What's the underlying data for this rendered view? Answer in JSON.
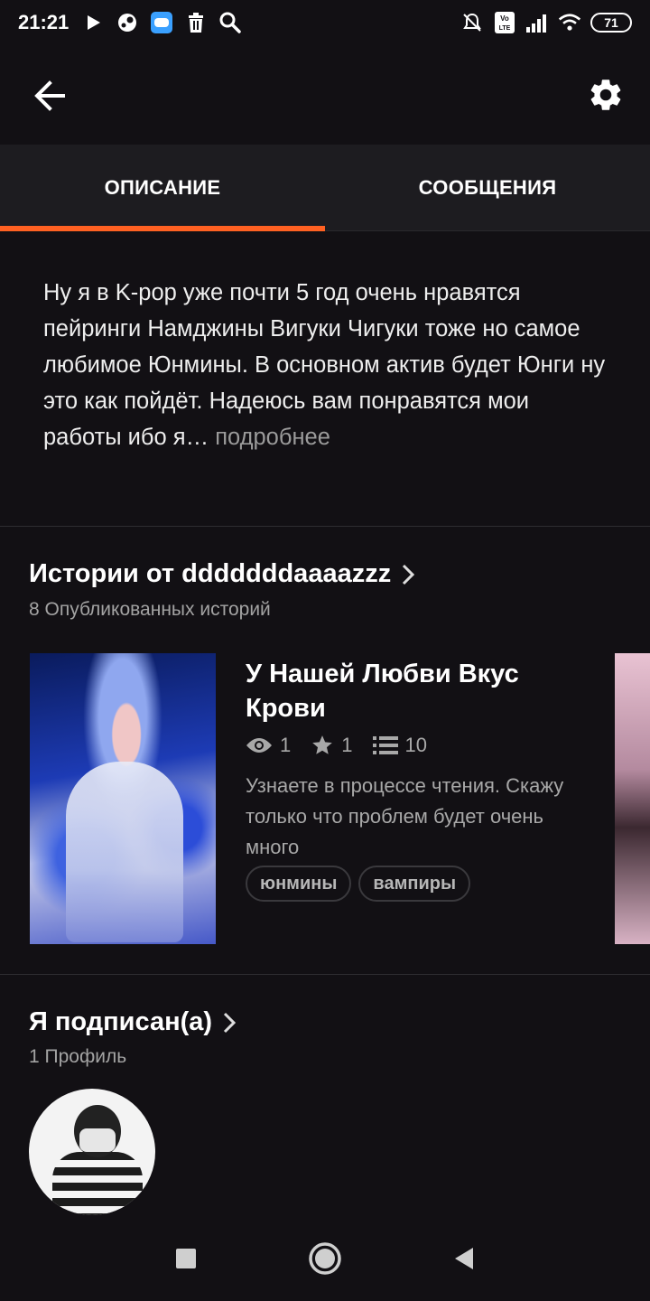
{
  "status_bar": {
    "time": "21:21",
    "battery": "71",
    "icons": [
      "play-icon",
      "steam-icon",
      "game-icon",
      "trash-icon",
      "search-icon",
      "mute-icon",
      "volte-icon",
      "signal-icon",
      "wifi-icon"
    ]
  },
  "app_bar": {
    "back_icon": "arrow-left-icon",
    "settings_icon": "gear-icon"
  },
  "tabs": [
    {
      "label": "ОПИСАНИЕ",
      "active": true
    },
    {
      "label": "СООБЩЕНИЯ",
      "active": false
    }
  ],
  "description": {
    "text": "Ну я в K-pop уже почти 5 год очень нравятся пейринги Намджины Вигуки Чигуки тоже но самое любимое Юнмины. В основном актив будет Юнги ну это как пойдёт. Надеюсь вам понравятся мои работы ибо я…",
    "more_label": " подробнее"
  },
  "stories_section": {
    "title": "Истории от dddddddaaaazzz",
    "subtitle": "8 Опубликованных историй",
    "story": {
      "title": "У Нашей Любви Вкус Крови",
      "views": "1",
      "votes": "1",
      "parts": "10",
      "description": "Узнаете в процессе чтения. Скажу только что проблем будет очень много",
      "tags": [
        "юнмины",
        "вампиры"
      ]
    }
  },
  "following_section": {
    "title": "Я подписан(а)",
    "subtitle": "1 Профиль"
  },
  "colors": {
    "accent": "#ff6122",
    "background": "#121014",
    "tab_bar": "#1d1c20"
  }
}
